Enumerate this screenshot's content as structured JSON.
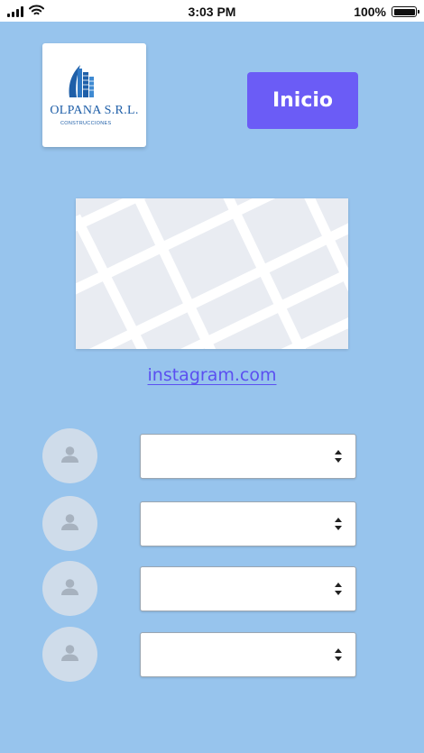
{
  "status_bar": {
    "time": "3:03 PM",
    "battery": "100%",
    "icons": [
      "signal-icon",
      "wifi-icon",
      "battery-icon"
    ]
  },
  "logo": {
    "title": "OLPANA S.R.L.",
    "subtitle": "CONSTRUCCIONES",
    "icon": "building-icon"
  },
  "header": {
    "inicio_label": "Inicio"
  },
  "map": {
    "icon": "map-placeholder"
  },
  "link": {
    "text": "instagram.com"
  },
  "rows": [
    {
      "avatar_icon": "user-icon",
      "select_value": ""
    },
    {
      "avatar_icon": "user-icon",
      "select_value": ""
    },
    {
      "avatar_icon": "user-icon",
      "select_value": ""
    },
    {
      "avatar_icon": "user-icon",
      "select_value": ""
    }
  ],
  "colors": {
    "background": "#97c4ed",
    "accent": "#6b5cf6",
    "link": "#5b4ff0",
    "logo_blue": "#1f5fa8"
  }
}
